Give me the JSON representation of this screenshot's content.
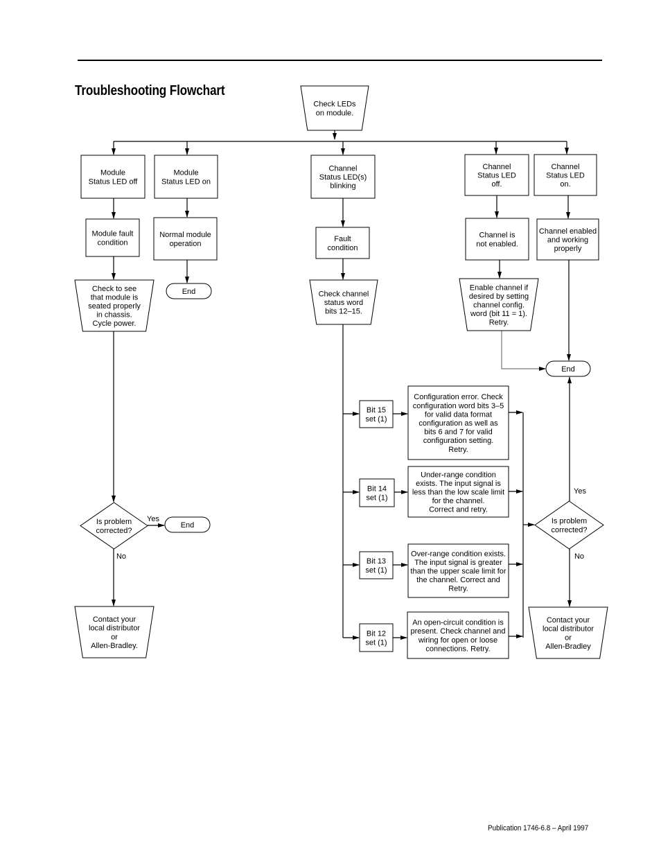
{
  "page": {
    "title": "Troubleshooting Flowchart",
    "footer": "Publication 1746-6.8 – April 1997"
  },
  "nodes": {
    "check_leds": {
      "shape": "manual",
      "lines": [
        "Check LEDs",
        "on module."
      ]
    },
    "module_led_off": {
      "shape": "process",
      "lines": [
        "Module",
        "Status LED off"
      ]
    },
    "module_led_on": {
      "shape": "process",
      "lines": [
        "Module",
        "Status LED on"
      ]
    },
    "channel_led_blinking": {
      "shape": "process",
      "lines": [
        "Channel",
        "Status LED(s)",
        "blinking"
      ]
    },
    "channel_led_off": {
      "shape": "process",
      "lines": [
        "Channel",
        "Status LED",
        "off."
      ]
    },
    "channel_led_on": {
      "shape": "process",
      "lines": [
        "Channel",
        "Status LED",
        "on."
      ]
    },
    "module_fault": {
      "shape": "process",
      "lines": [
        "Module fault",
        "condition"
      ]
    },
    "normal_operation": {
      "shape": "process",
      "lines": [
        "Normal module",
        "operation"
      ]
    },
    "fault_condition": {
      "shape": "process",
      "lines": [
        "Fault",
        "condition"
      ]
    },
    "channel_not_enabled": {
      "shape": "process",
      "lines": [
        "Channel is",
        "not enabled."
      ]
    },
    "channel_working": {
      "shape": "process",
      "lines": [
        "Channel enabled",
        "and working",
        "properly"
      ]
    },
    "check_seated": {
      "shape": "manual",
      "lines": [
        "Check to see",
        "that module is",
        "seated properly",
        "in chassis.",
        "Cycle power."
      ]
    },
    "end_normal": {
      "shape": "terminal",
      "lines": [
        "End"
      ]
    },
    "check_status_word": {
      "shape": "manual",
      "lines": [
        "Check channel",
        "status word",
        "bits 12–15."
      ]
    },
    "enable_channel": {
      "shape": "manual",
      "lines": [
        "Enable channel if",
        "desired by setting",
        "channel config.",
        "word (bit 11 = 1).",
        "Retry."
      ]
    },
    "end_right": {
      "shape": "terminal",
      "lines": [
        "End"
      ]
    },
    "bit15": {
      "shape": "process",
      "lines": [
        "Bit 15",
        "set (1)"
      ]
    },
    "bit14": {
      "shape": "process",
      "lines": [
        "Bit 14",
        "set (1)"
      ]
    },
    "bit13": {
      "shape": "process",
      "lines": [
        "Bit 13",
        "set (1)"
      ]
    },
    "bit12": {
      "shape": "process",
      "lines": [
        "Bit 12",
        "set (1)"
      ]
    },
    "config_error": {
      "shape": "process",
      "lines": [
        "Configuration error.  Check",
        "configuration word bits 3–5",
        "for valid data format",
        "configuration as well as",
        "bits 6 and 7 for valid",
        "configuration setting.",
        "Retry."
      ]
    },
    "under_range": {
      "shape": "process",
      "lines": [
        "Under-range condition",
        "exists.  The input signal is",
        "less than the low scale limit",
        "for the channel.",
        "Correct and retry."
      ]
    },
    "over_range": {
      "shape": "process",
      "lines": [
        "Over-range condition exists.",
        "The input signal is greater",
        "than the upper scale limit for",
        "the channel.  Correct and",
        "Retry."
      ]
    },
    "open_circuit": {
      "shape": "process",
      "lines": [
        "An open-circuit condition is",
        "present.  Check channel and",
        "wiring for open or loose",
        "connections.  Retry."
      ]
    },
    "decision_left": {
      "shape": "decision",
      "lines": [
        "Is problem",
        "corrected?"
      ]
    },
    "end_left": {
      "shape": "terminal",
      "lines": [
        "End"
      ]
    },
    "contact_left": {
      "shape": "manual",
      "lines": [
        "Contact your",
        "local distributor",
        "or",
        "Allen-Bradley."
      ]
    },
    "decision_right": {
      "shape": "decision",
      "lines": [
        "Is problem",
        "corrected?"
      ]
    },
    "contact_right": {
      "shape": "manual",
      "lines": [
        "Contact your",
        "local distributor",
        "or",
        "Allen-Bradley"
      ]
    }
  },
  "edges": [
    {
      "from": "check_leds",
      "to": "module_led_off"
    },
    {
      "from": "check_leds",
      "to": "module_led_on"
    },
    {
      "from": "check_leds",
      "to": "channel_led_blinking"
    },
    {
      "from": "check_leds",
      "to": "channel_led_off"
    },
    {
      "from": "check_leds",
      "to": "channel_led_on"
    },
    {
      "from": "module_led_off",
      "to": "module_fault"
    },
    {
      "from": "module_led_on",
      "to": "normal_operation"
    },
    {
      "from": "channel_led_blinking",
      "to": "fault_condition"
    },
    {
      "from": "channel_led_off",
      "to": "channel_not_enabled"
    },
    {
      "from": "channel_led_on",
      "to": "channel_working"
    },
    {
      "from": "module_fault",
      "to": "check_seated"
    },
    {
      "from": "normal_operation",
      "to": "end_normal"
    },
    {
      "from": "fault_condition",
      "to": "check_status_word"
    },
    {
      "from": "channel_not_enabled",
      "to": "enable_channel"
    },
    {
      "from": "channel_working",
      "to": "end_right"
    },
    {
      "from": "enable_channel",
      "to": "end_right"
    },
    {
      "from": "check_seated",
      "to": "decision_left"
    },
    {
      "from": "decision_left",
      "to": "end_left",
      "label": "Yes"
    },
    {
      "from": "decision_left",
      "to": "contact_left",
      "label": "No"
    },
    {
      "from": "check_status_word",
      "to": "bit15"
    },
    {
      "from": "check_status_word",
      "to": "bit14"
    },
    {
      "from": "check_status_word",
      "to": "bit13"
    },
    {
      "from": "check_status_word",
      "to": "bit12"
    },
    {
      "from": "bit15",
      "to": "config_error"
    },
    {
      "from": "bit14",
      "to": "under_range"
    },
    {
      "from": "bit13",
      "to": "over_range"
    },
    {
      "from": "bit12",
      "to": "open_circuit"
    },
    {
      "from": "config_error",
      "to": "decision_right"
    },
    {
      "from": "under_range",
      "to": "decision_right"
    },
    {
      "from": "over_range",
      "to": "decision_right"
    },
    {
      "from": "open_circuit",
      "to": "decision_right"
    },
    {
      "from": "decision_right",
      "to": "end_right",
      "label": "Yes"
    },
    {
      "from": "decision_right",
      "to": "contact_right",
      "label": "No"
    }
  ]
}
